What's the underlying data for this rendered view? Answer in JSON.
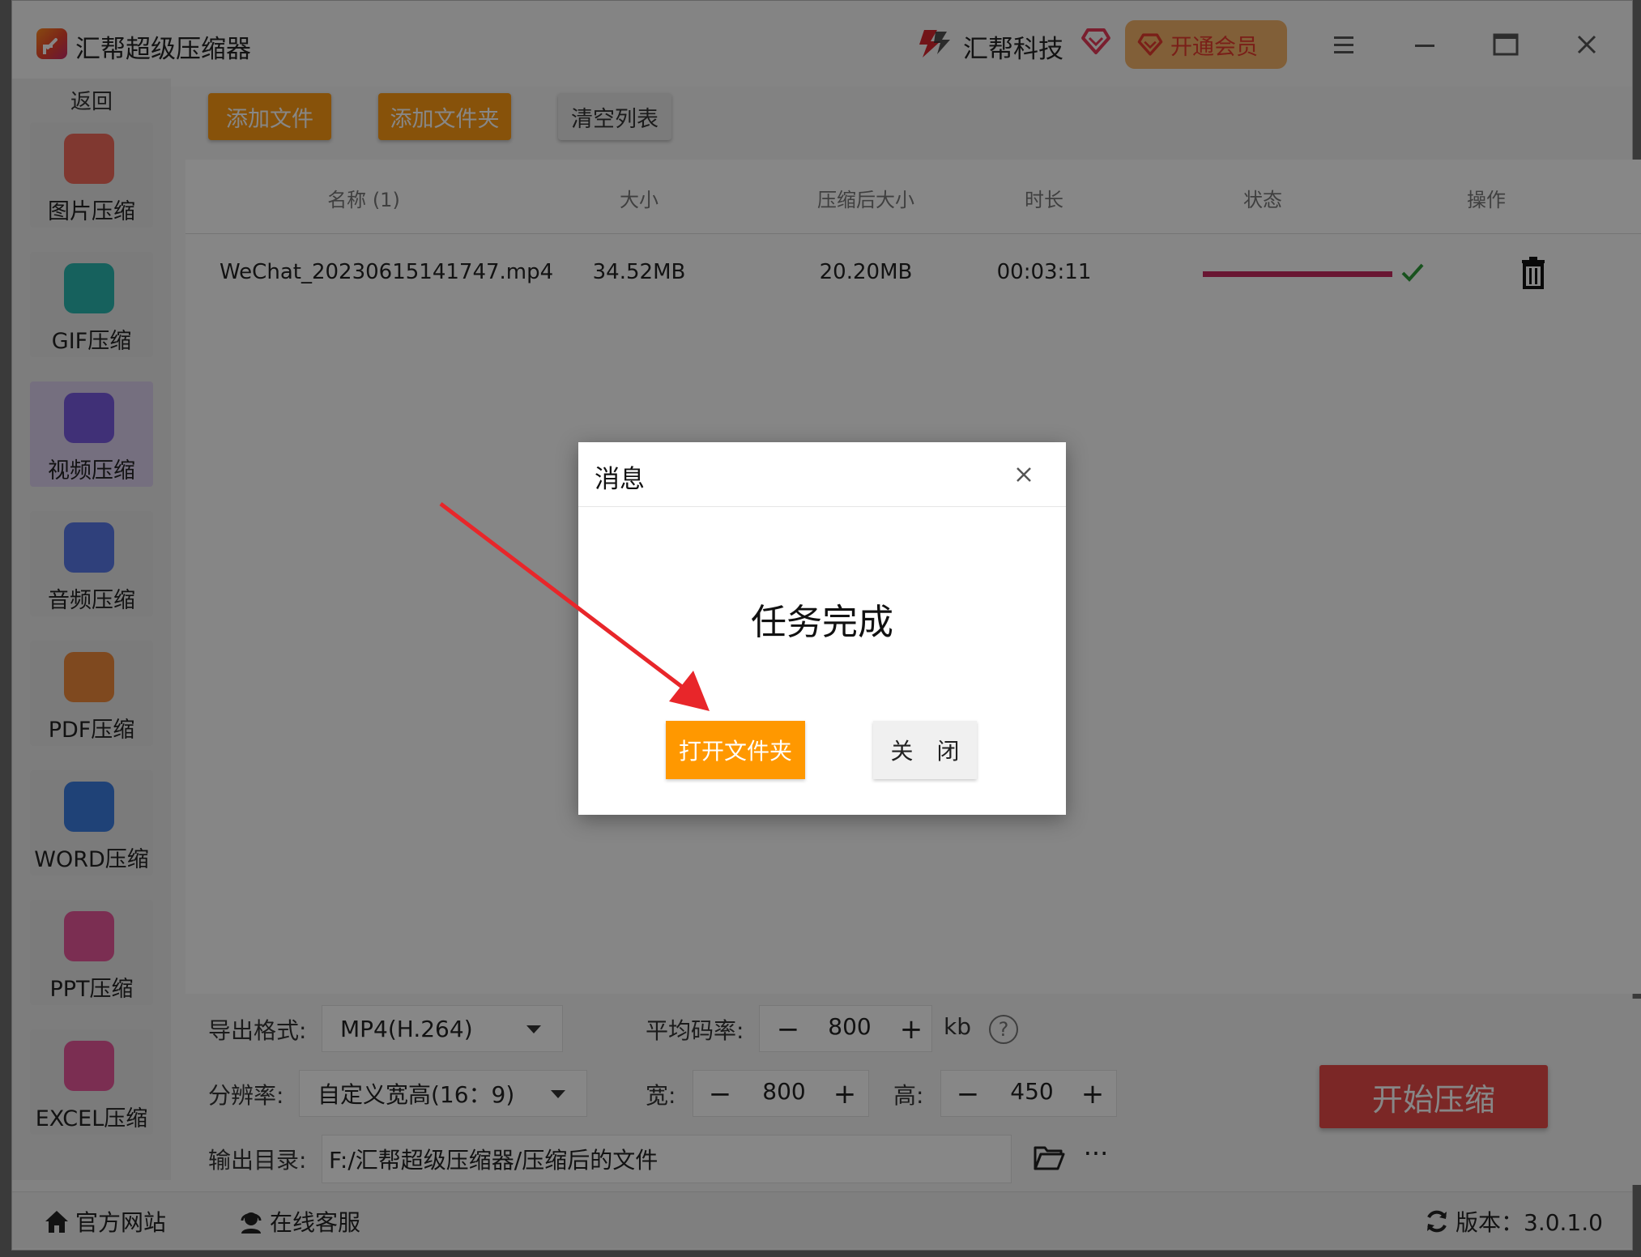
{
  "titlebar": {
    "app_title": "汇帮超级压缩器",
    "brand_name": "汇帮科技",
    "vip_label": "开通会员"
  },
  "sidebar": {
    "back_label": "返回",
    "items": [
      {
        "label": "图片压缩",
        "icon": "image-compress-icon",
        "color": "#f26b5b"
      },
      {
        "label": "GIF压缩",
        "icon": "gif-compress-icon",
        "color": "#2bb7b0"
      },
      {
        "label": "视频压缩",
        "icon": "video-compress-icon",
        "color": "#7a5be0",
        "active": true
      },
      {
        "label": "音频压缩",
        "icon": "audio-compress-icon",
        "color": "#5a7ae8"
      },
      {
        "label": "PDF压缩",
        "icon": "pdf-compress-icon",
        "color": "#f08a3c"
      },
      {
        "label": "WORD压缩",
        "icon": "word-compress-icon",
        "color": "#3b7de0"
      },
      {
        "label": "PPT压缩",
        "icon": "ppt-compress-icon",
        "color": "#e9589c"
      },
      {
        "label": "EXCEL压缩",
        "icon": "excel-compress-icon",
        "color": "#e9589c"
      }
    ]
  },
  "toolbar": {
    "add_file": "添加文件",
    "add_folder": "添加文件夹",
    "clear_list": "清空列表"
  },
  "table": {
    "columns": [
      "名称 (1)",
      "大小",
      "压缩后大小",
      "时长",
      "状态",
      "操作"
    ],
    "rows": [
      {
        "name": "WeChat_20230615141747.mp4",
        "size": "34.52MB",
        "compressed_size": "20.20MB",
        "duration": "00:03:11",
        "progress": 1.0
      }
    ]
  },
  "settings": {
    "format_label": "导出格式:",
    "format_value": "MP4(H.264)",
    "bitrate_label": "平均码率:",
    "bitrate_value": "800",
    "bitrate_unit": "kb",
    "help_symbol": "?",
    "resolution_label": "分辨率:",
    "resolution_value": "自定义宽高(16：9)",
    "width_label": "宽:",
    "width_value": "800",
    "height_label": "高:",
    "height_value": "450",
    "minus": "−",
    "plus": "+",
    "output_label": "输出目录:",
    "output_path": "F:/汇帮超级压缩器/压缩后的文件",
    "more_symbol": "···",
    "start_button": "开始压缩"
  },
  "footer": {
    "website": "官方网站",
    "support": "在线客服",
    "version": "版本：3.0.1.0"
  },
  "dialog": {
    "title": "消息",
    "message": "任务完成",
    "open_folder": "打开文件夹",
    "close": "关 闭"
  },
  "colors": {
    "accent_orange": "#ff9b14",
    "start_red": "#e94a48",
    "progress": "#c62b5f",
    "check_green": "#2e9b3a",
    "arrow_red": "#e8262a"
  }
}
